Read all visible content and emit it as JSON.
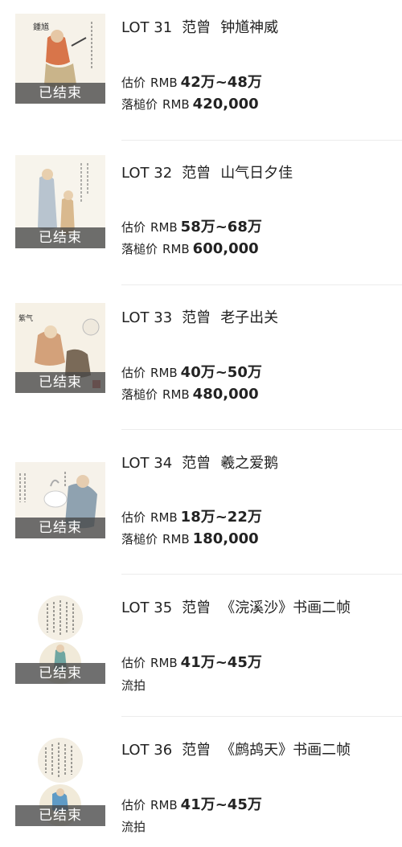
{
  "lots": [
    {
      "lot": "LOT 31",
      "artist": "范曾",
      "work": "钟馗神威",
      "status": "已结束",
      "estimate_label": "估价",
      "currency": "RMB",
      "estimate": "42万~48万",
      "result_label": "落槌价",
      "result_currency": "RMB",
      "result": "420,000"
    },
    {
      "lot": "LOT 32",
      "artist": "范曾",
      "work": "山气日夕佳",
      "status": "已结束",
      "estimate_label": "估价",
      "currency": "RMB",
      "estimate": "58万~68万",
      "result_label": "落槌价",
      "result_currency": "RMB",
      "result": "600,000"
    },
    {
      "lot": "LOT 33",
      "artist": "范曾",
      "work": "老子出关",
      "status": "已结束",
      "estimate_label": "估价",
      "currency": "RMB",
      "estimate": "40万~50万",
      "result_label": "落槌价",
      "result_currency": "RMB",
      "result": "480,000"
    },
    {
      "lot": "LOT 34",
      "artist": "范曾",
      "work": "羲之爱鹅",
      "status": "已结束",
      "estimate_label": "估价",
      "currency": "RMB",
      "estimate": "18万~22万",
      "result_label": "落槌价",
      "result_currency": "RMB",
      "result": "180,000"
    },
    {
      "lot": "LOT 35",
      "artist": "范曾",
      "work": "《浣溪沙》书画二帧",
      "status": "已结束",
      "estimate_label": "估价",
      "currency": "RMB",
      "estimate": "41万~45万",
      "result_label": "流拍",
      "result_currency": "",
      "result": ""
    },
    {
      "lot": "LOT 36",
      "artist": "范曾",
      "work": "《鹧鸪天》书画二帧",
      "status": "已结束",
      "estimate_label": "估价",
      "currency": "RMB",
      "estimate": "41万~45万",
      "result_label": "流拍",
      "result_currency": "",
      "result": ""
    }
  ]
}
